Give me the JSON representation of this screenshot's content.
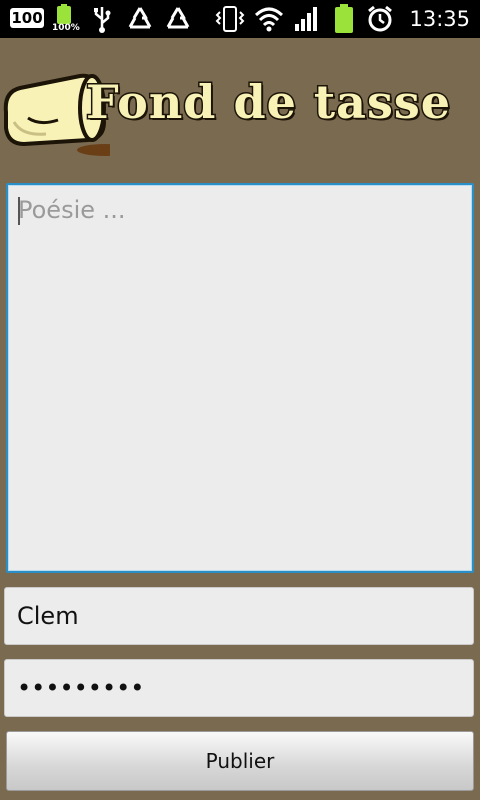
{
  "status_bar": {
    "notification_badge": "100",
    "battery_percent_label": "100%",
    "time": "13:35",
    "icons": [
      "notification-badge-icon",
      "battery-small-icon",
      "usb-icon",
      "recycle-icon",
      "recycle-icon",
      "vibrate-icon",
      "wifi-icon",
      "signal-icon",
      "battery-icon",
      "alarm-icon"
    ]
  },
  "header": {
    "title": "Fond de tasse"
  },
  "form": {
    "poem_placeholder": "Poésie ...",
    "poem_value": "",
    "name_value": "Clem",
    "password_value": "123456789",
    "publish_label": "Publier"
  },
  "colors": {
    "background": "#7a6a50",
    "status_bar": "#000000",
    "focus_border": "#2a8fc7",
    "field_background": "#ececec",
    "logo_text": "#f9f2b6"
  }
}
